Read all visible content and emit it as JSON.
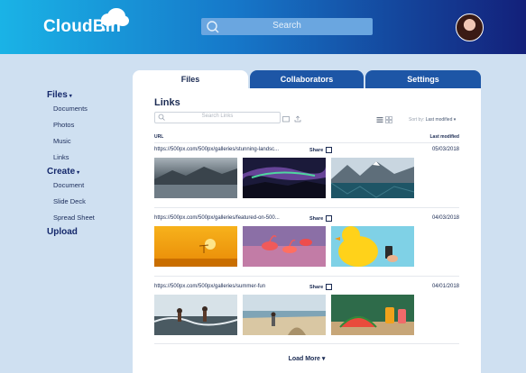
{
  "header": {
    "logo": "CloudBin",
    "search_placeholder": "Search",
    "avatar": "user-avatar",
    "colors": {
      "gradient_start": "#1ab3e6",
      "gradient_end": "#13207a"
    }
  },
  "sidebar": {
    "groups": [
      {
        "label": "Files",
        "caret": "▾",
        "items": [
          "Documents",
          "Photos",
          "Music",
          "Links"
        ]
      },
      {
        "label": "Create",
        "caret": "▾",
        "items": [
          "Document",
          "Slide Deck",
          "Spread Sheet"
        ]
      },
      {
        "label": "Upload",
        "caret": "",
        "items": []
      }
    ]
  },
  "tabs": [
    {
      "label": "Files",
      "active": true
    },
    {
      "label": "Collaborators",
      "active": false
    },
    {
      "label": "Settings",
      "active": false
    }
  ],
  "panel": {
    "title": "Links",
    "search_placeholder": "Search Links",
    "sort_label": "Sort by:",
    "sort_value": "Last modified ▾",
    "col_url": "URL",
    "col_modified": "Last modified",
    "load_more": "Load More ▾"
  },
  "rows": [
    {
      "url": "https://500px.com/500px/galleries/stunning-landsc...",
      "share": "Share",
      "date": "05/03/2018",
      "thumbs": [
        "misty-lake-photo",
        "aurora-night-photo",
        "mountain-lake-photo"
      ]
    },
    {
      "url": "https://500px.com/500px/galleries/featured-on-500...",
      "share": "Share",
      "date": "04/03/2018",
      "thumbs": [
        "savanna-sunset-photo",
        "flamingos-photo",
        "rubber-duck-photo"
      ]
    },
    {
      "url": "https://500px.com/500px/galleries/summer-fun",
      "share": "Share",
      "date": "04/01/2018",
      "thumbs": [
        "beach-splash-photo",
        "beach-dunes-photo",
        "watermelon-drinks-photo"
      ]
    }
  ]
}
